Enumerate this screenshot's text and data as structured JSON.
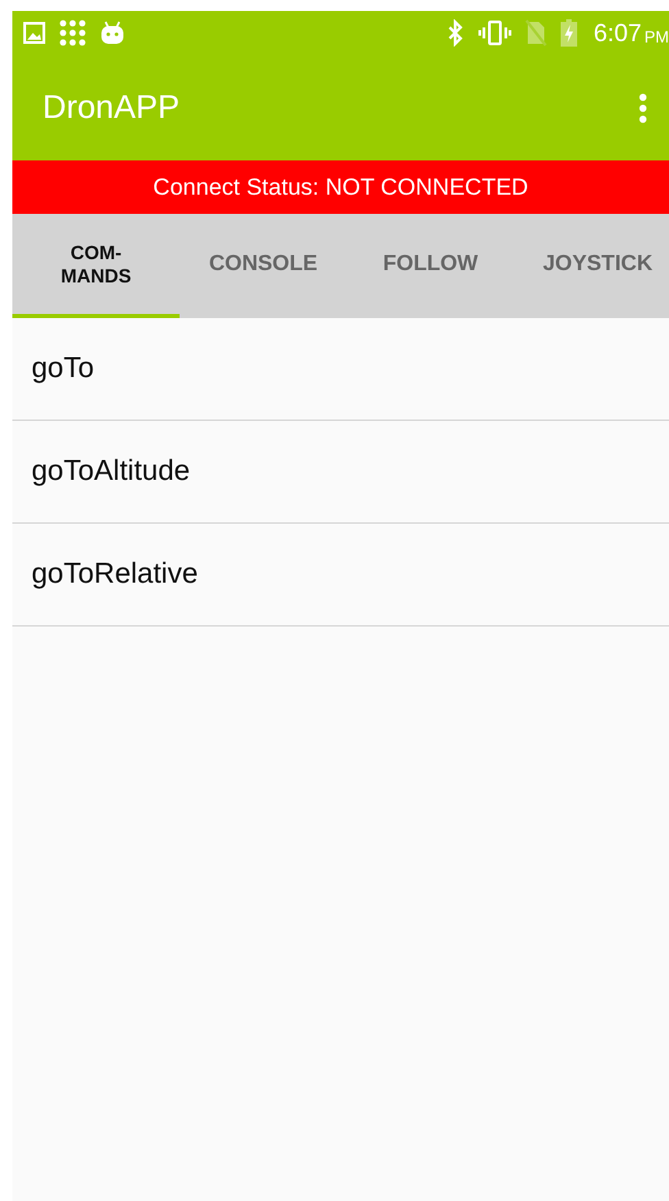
{
  "status_bar": {
    "time": "6:07",
    "meridiem": "PM"
  },
  "app_bar": {
    "title": "DronAPP"
  },
  "connection_banner": {
    "text": "Connect Status: NOT CONNECTED"
  },
  "tabs": [
    {
      "label": "COM-\nMANDS",
      "selected": true
    },
    {
      "label": "CONSOLE",
      "selected": false
    },
    {
      "label": "FOLLOW",
      "selected": false
    },
    {
      "label": "JOYSTICK",
      "selected": false
    }
  ],
  "commands": [
    {
      "label": "goTo"
    },
    {
      "label": "goToAltitude"
    },
    {
      "label": "goToRelative"
    }
  ]
}
